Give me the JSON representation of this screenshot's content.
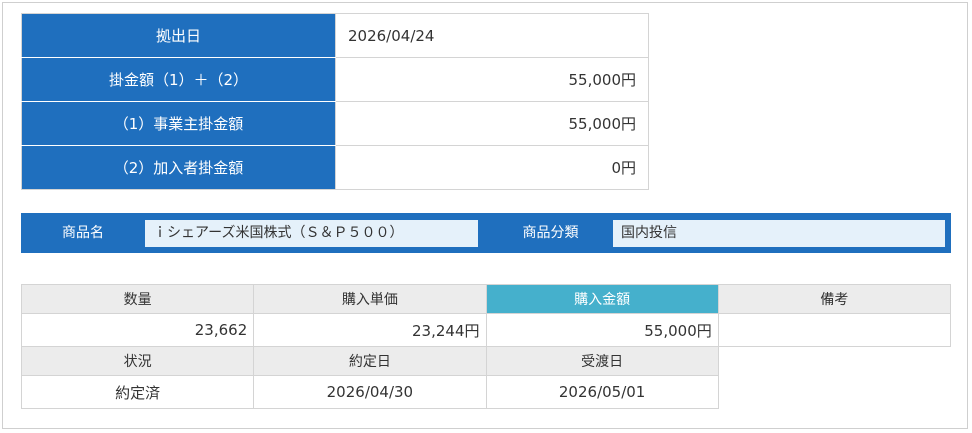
{
  "summary": {
    "rows": [
      {
        "label": "拠出日",
        "value": "2026/04/24"
      },
      {
        "label": "掛金額（1）＋（2）",
        "value": "55,000円"
      },
      {
        "label": "（1）事業主掛金額",
        "value": "55,000円"
      },
      {
        "label": "（2）加入者掛金額",
        "value": "0円"
      }
    ]
  },
  "product": {
    "name_label": "商品名",
    "name_value": "ｉシェアーズ米国株式（Ｓ＆Ｐ５００）",
    "category_label": "商品分類",
    "category_value": "国内投信"
  },
  "detail": {
    "headers1": [
      "数量",
      "購入単価",
      "購入金額",
      "備考"
    ],
    "values1": [
      "23,662",
      "23,244円",
      "55,000円",
      ""
    ],
    "headers2": [
      "状況",
      "約定日",
      "受渡日"
    ],
    "values2": [
      "約定済",
      "2026/04/30",
      "2026/05/01"
    ]
  },
  "colors": {
    "header_blue": "#1f6fbe",
    "accent_teal": "#45b0cc",
    "header_gray": "#ececec"
  }
}
